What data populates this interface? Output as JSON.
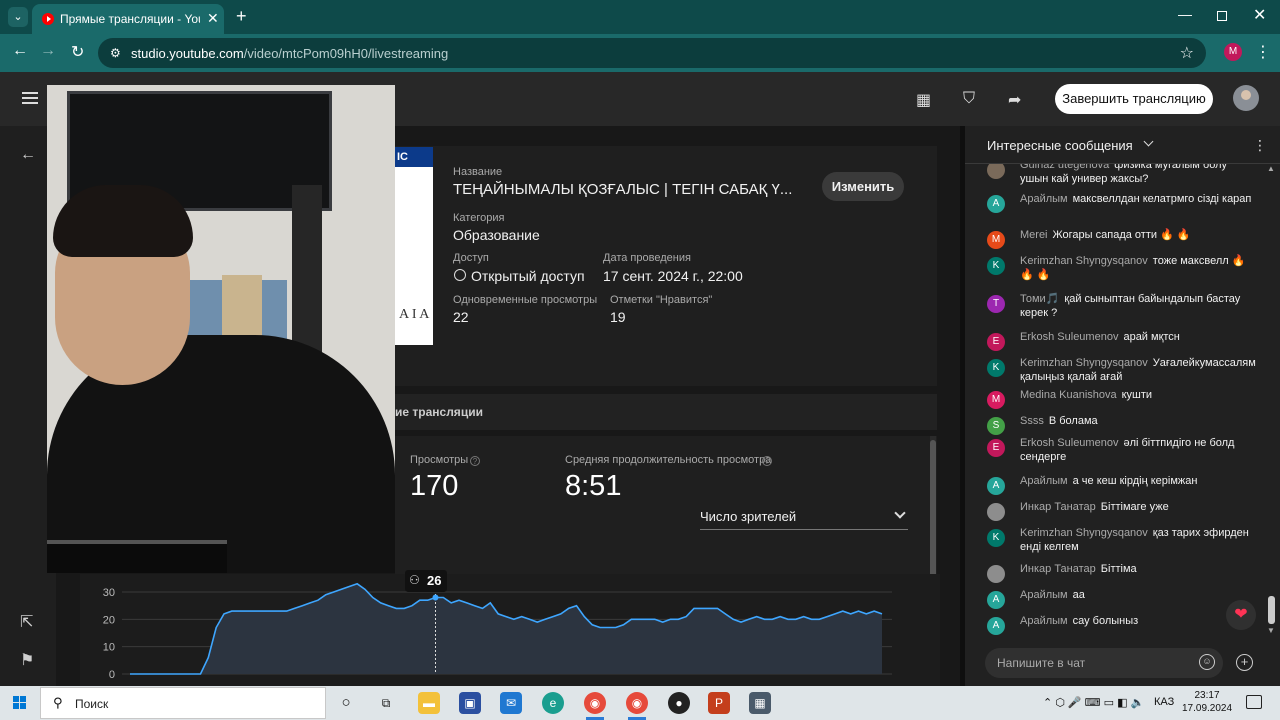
{
  "browser": {
    "tab_title": "Прямые трансляции - YouTube",
    "url_host": "studio.youtube.com",
    "url_path": "/video/mtcPom09hH0/livestreaming",
    "profile_initial": "M"
  },
  "header": {
    "end_stream_label": "Завершить трансляцию"
  },
  "details": {
    "thumb_band": "IC",
    "thumb_mark": "A I A",
    "title_label": "Название",
    "title_value": "ТЕҢАЙНЫМАЛЫ ҚОЗҒАЛЫС | ТЕГІН САБАҚ Ү...",
    "edit_label": "Изменить",
    "category_label": "Категория",
    "category_value": "Образование",
    "access_label": "Доступ",
    "access_value": "Открытый доступ",
    "date_label": "Дата проведения",
    "date_value": "17 сент. 2024 г., 22:00",
    "concurrent_label": "Одновременные просмотры",
    "concurrent_value": "22",
    "likes_label": "Отметки \"Нравится\"",
    "likes_value": "19"
  },
  "analytics": {
    "section_title": "ие трансляции",
    "views_label": "Просмотры",
    "views_value": "170",
    "avg_label": "Средняя продолжительность просмотра",
    "avg_value": "8:51",
    "metric_select": "Число зрителей",
    "tooltip_value": "26"
  },
  "chart_data": {
    "type": "area",
    "ylim": [
      0,
      30
    ],
    "yticks": [
      "30",
      "20",
      "10",
      "0"
    ],
    "grid": true,
    "values": [
      0,
      0,
      0,
      0,
      0,
      0,
      0,
      0,
      0,
      0,
      6,
      17,
      22,
      23,
      23,
      23,
      23,
      23,
      23,
      23,
      23,
      24,
      25,
      26,
      27,
      29,
      30,
      31,
      32,
      33,
      31,
      28,
      26,
      25,
      24,
      24,
      25,
      27,
      27,
      28,
      28,
      26,
      27,
      26,
      25,
      24,
      26,
      22,
      21,
      20,
      21,
      20,
      19,
      20,
      21,
      22,
      24,
      25,
      21,
      18,
      17,
      17,
      17,
      18,
      20,
      20,
      20,
      20,
      19,
      20,
      20,
      21,
      24,
      24,
      24,
      24,
      22,
      20,
      19,
      20,
      21,
      20,
      20,
      21,
      20,
      20,
      21,
      20,
      20,
      21,
      22,
      23,
      22,
      23,
      22,
      23,
      22
    ]
  },
  "chat": {
    "title": "Интересные сообщения",
    "input_placeholder": "Напишите в чат",
    "messages": [
      {
        "initial": "",
        "color": "#7a6a5a",
        "author": "Gulnaz utegenova",
        "text": "физика мугалым болу ушын кай универ жаксы?"
      },
      {
        "initial": "А",
        "color": "#26a69a",
        "author": "Арайлым",
        "text": "максвеллдан келатрмго сізді карап"
      },
      {
        "initial": "M",
        "color": "#e64a19",
        "author": "Merei",
        "text": "Жогары сапада отти 🔥 🔥"
      },
      {
        "initial": "K",
        "color": "#00796b",
        "author": "Kerimzhan Shyngysqanov",
        "text": "тоже максвелл 🔥 🔥 🔥"
      },
      {
        "initial": "Т",
        "color": "#9c27b0",
        "author": "Томи🎵",
        "text": "қай сыныптан байындалып бастау керек ?"
      },
      {
        "initial": "E",
        "color": "#c2185b",
        "author": "Erkosh Suleumenov",
        "text": "арай мқтсн"
      },
      {
        "initial": "K",
        "color": "#00796b",
        "author": "Kerimzhan Shyngysqanov",
        "text": "Уағалейкумассалям қалыңыз қалай ағай"
      },
      {
        "initial": "M",
        "color": "#d81b60",
        "author": "Medina Kuanishova",
        "text": "кушти"
      },
      {
        "initial": "S",
        "color": "#43a047",
        "author": "Ssss",
        "text": "В болама"
      },
      {
        "initial": "E",
        "color": "#c2185b",
        "author": "Erkosh Suleumenov",
        "text": "әлі біттпидіго не болд сендерге"
      },
      {
        "initial": "А",
        "color": "#26a69a",
        "author": "Арайлым",
        "text": "а че кеш кірдің керімжан"
      },
      {
        "initial": "",
        "color": "#8d8d8d",
        "author": "Инкар Танатар",
        "text": "Біттімаге уже"
      },
      {
        "initial": "K",
        "color": "#00796b",
        "author": "Kerimzhan Shyngysqanov",
        "text": "қаз тарих эфирден енді келгем"
      },
      {
        "initial": "",
        "color": "#8d8d8d",
        "author": "Инкар Танатар",
        "text": "Біттіма"
      },
      {
        "initial": "А",
        "color": "#26a69a",
        "author": "Арайлым",
        "text": "аа"
      },
      {
        "initial": "А",
        "color": "#26a69a",
        "author": "Арайлым",
        "text": "сау болыныз"
      }
    ]
  },
  "taskbar": {
    "search_placeholder": "Поиск",
    "language": "КАЗ",
    "time": "23:17",
    "date": "17.09.2024"
  }
}
